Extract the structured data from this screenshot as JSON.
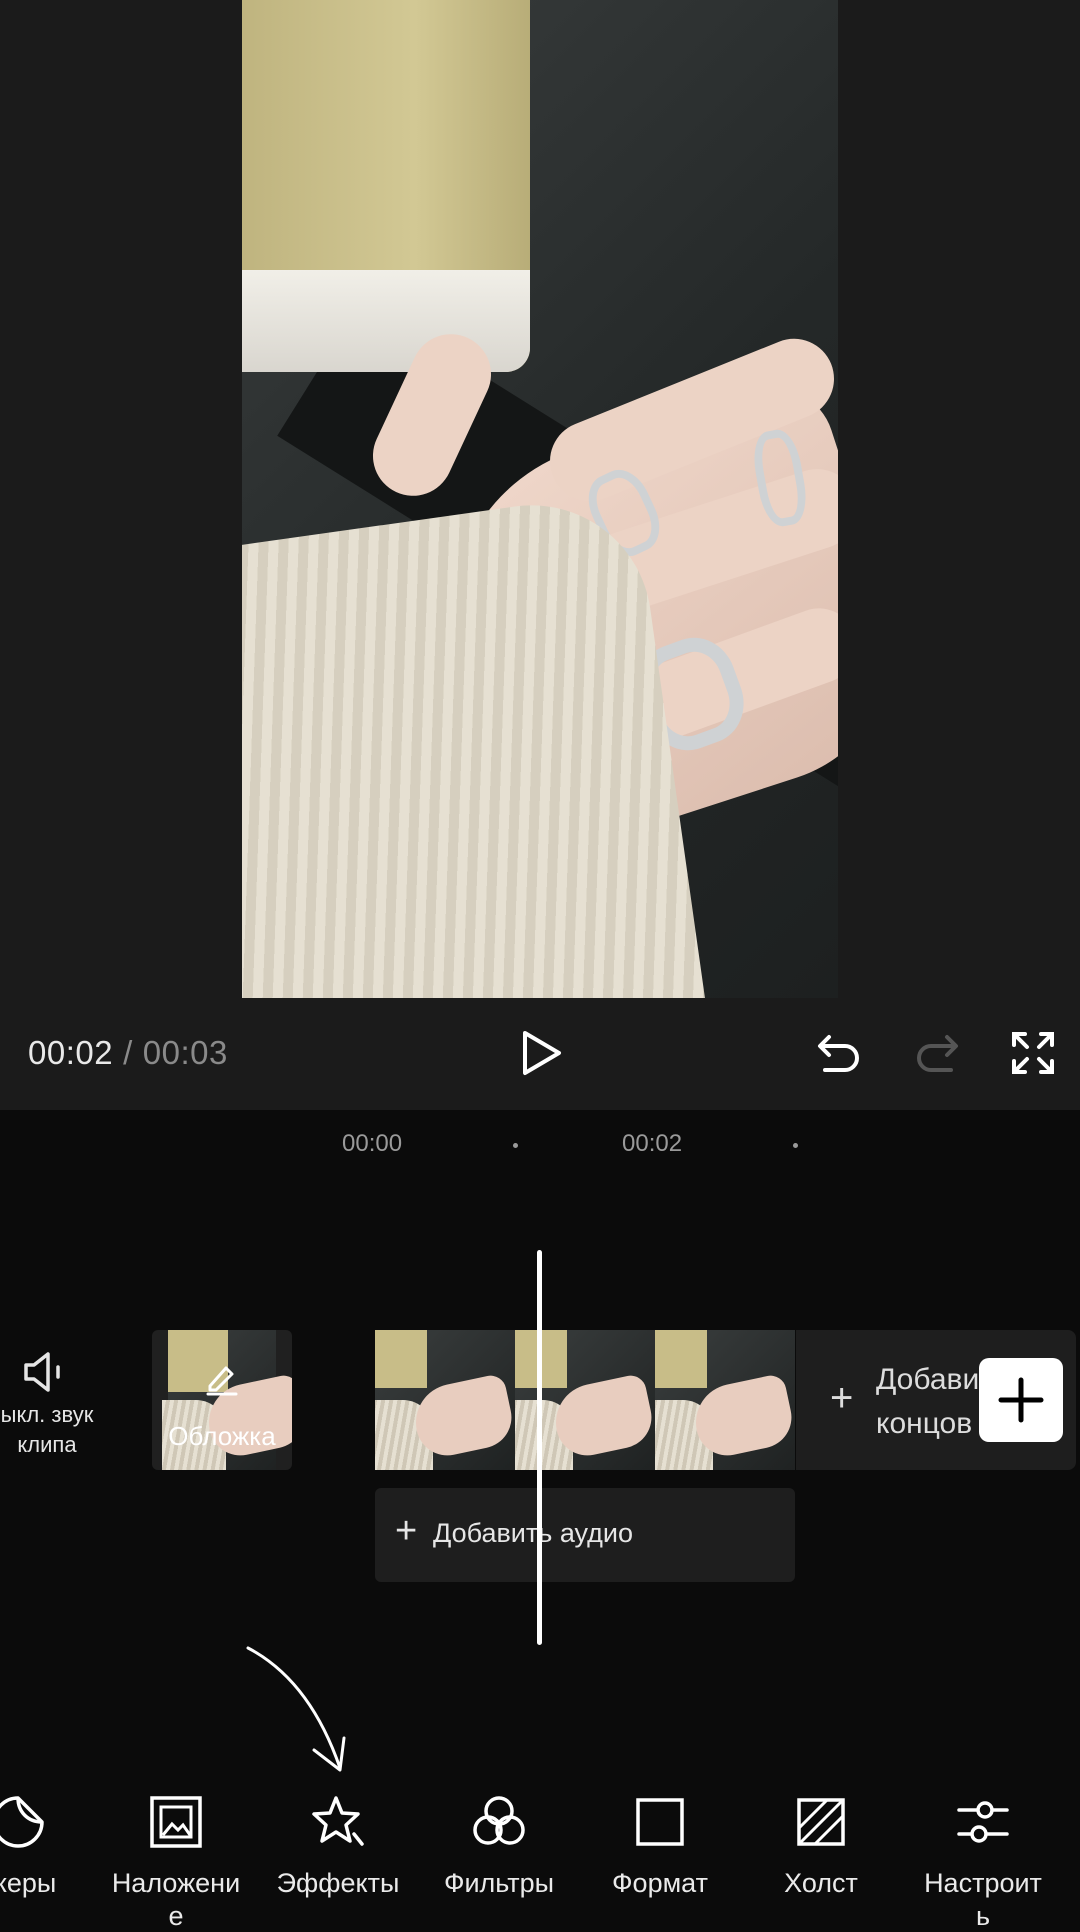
{
  "player": {
    "current_time": "00:02",
    "separator": "/",
    "total_time": "00:03"
  },
  "timeline": {
    "ruler": [
      "00:00",
      "00:02"
    ],
    "mute_label_line1": "ыкл. звук",
    "mute_label_line2": "клипа",
    "cover_label": "Обложка",
    "add_ending_line1": "Добави",
    "add_ending_line2": "концов",
    "add_audio_label": "Добавить аудио",
    "plus_symbol": "+"
  },
  "toolbar": [
    {
      "label": "икеры",
      "icon": "sticker-icon"
    },
    {
      "label": "Наложени",
      "sub": "е",
      "icon": "overlay-icon"
    },
    {
      "label": "Эффекты",
      "icon": "effects-icon"
    },
    {
      "label": "Фильтры",
      "icon": "filters-icon"
    },
    {
      "label": "Формат",
      "icon": "format-icon"
    },
    {
      "label": "Холст",
      "icon": "canvas-icon"
    },
    {
      "label": "Настроит",
      "sub": "ь",
      "icon": "adjust-icon"
    }
  ],
  "colors": {
    "background": "#0b0b0b",
    "preview_bg": "#1b1b1b",
    "accent_white": "#ffffff",
    "muted_text": "#8a8a8a"
  }
}
